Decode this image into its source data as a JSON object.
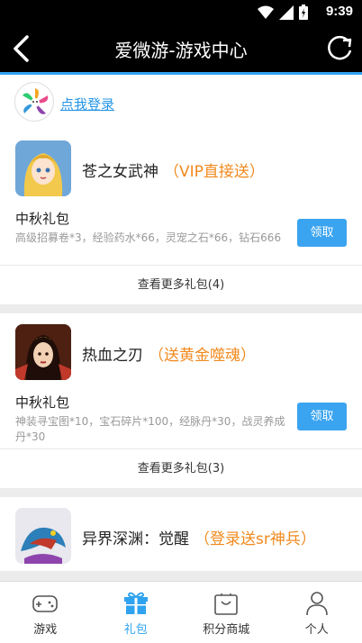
{
  "status_bar": {
    "time": "9:39"
  },
  "app_bar": {
    "title": "爱微游-游戏中心"
  },
  "login": {
    "link_text": "点我登录"
  },
  "games": [
    {
      "name": "苍之女武神",
      "promo": "（VIP直接送）",
      "gift_title": "中秋礼包",
      "gift_desc": "高级招募卷*3，经验药水*66，灵宠之石*66，钻石666",
      "claim_label": "领取",
      "more_label": "查看更多礼包(4)"
    },
    {
      "name": "热血之刃",
      "promo": "（送黄金噬魂）",
      "gift_title": "中秋礼包",
      "gift_desc": "神装寻宝图*10，宝石碎片*100，经脉丹*30，战灵养成丹*30",
      "claim_label": "领取",
      "more_label": "查看更多礼包(3)"
    },
    {
      "name": "异界深渊：觉醒",
      "promo": "（登录送sr神兵）"
    }
  ],
  "tabs": [
    {
      "label": "游戏",
      "icon": "gamepad-icon"
    },
    {
      "label": "礼包",
      "icon": "gift-icon",
      "active": true
    },
    {
      "label": "积分商城",
      "icon": "shopping-bag-icon"
    },
    {
      "label": "个人",
      "icon": "person-icon"
    }
  ],
  "colors": {
    "accent": "#2fa3f0",
    "promo": "#f08a1e",
    "claim_button": "#3aa4f0"
  }
}
